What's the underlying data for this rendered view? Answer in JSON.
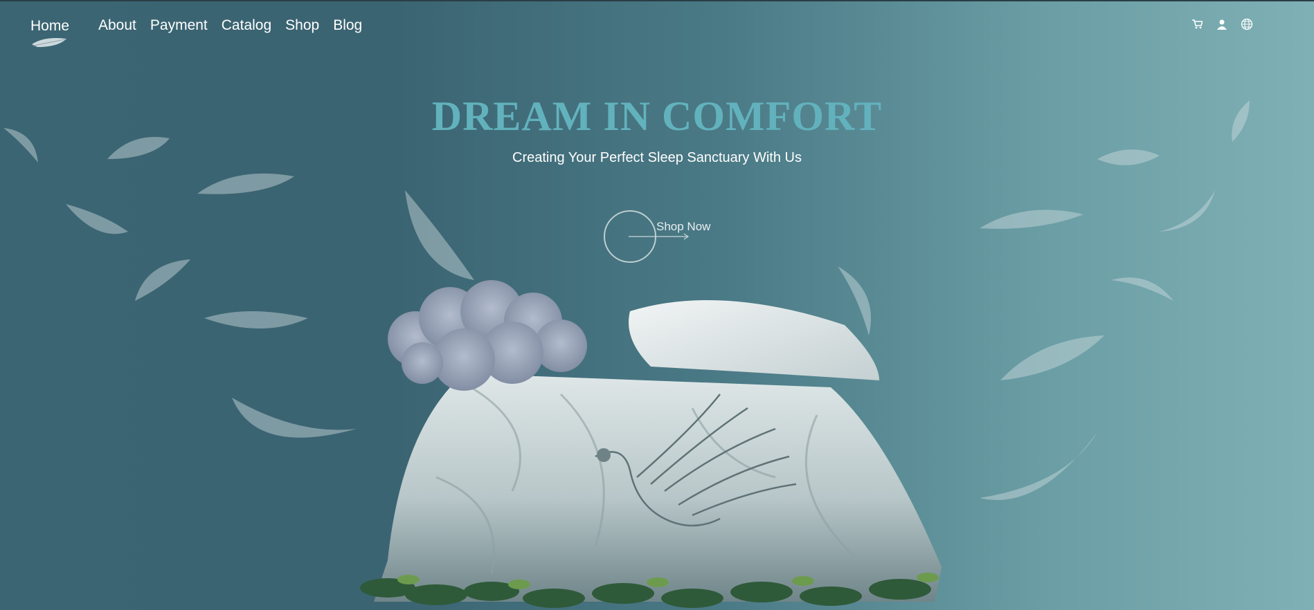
{
  "header": {
    "logo_label": "Home",
    "nav": [
      "About",
      "Payment",
      "Catalog",
      "Shop",
      "Blog"
    ],
    "icons": [
      "cart-icon",
      "user-icon",
      "globe-icon"
    ]
  },
  "hero": {
    "title": "DREAM IN COMFORT",
    "subtitle": "Creating Your Perfect Sleep Sanctuary With Us",
    "cta_label": "Shop Now"
  },
  "colors": {
    "title": "#62b2bd",
    "bg_left": "#3b6573",
    "bg_right": "#7fb0b5"
  }
}
